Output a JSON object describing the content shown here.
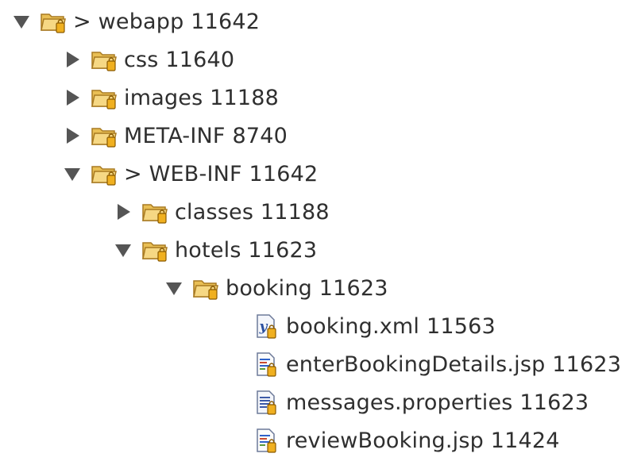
{
  "tree": {
    "webapp": {
      "prefix": ">",
      "name": "webapp",
      "rev": "11642"
    },
    "css": {
      "name": "css",
      "rev": "11640"
    },
    "images": {
      "name": "images",
      "rev": "11188"
    },
    "meta_inf": {
      "name": "META-INF",
      "rev": "8740"
    },
    "web_inf": {
      "prefix": ">",
      "name": "WEB-INF",
      "rev": "11642"
    },
    "classes": {
      "name": "classes",
      "rev": "11188"
    },
    "hotels": {
      "name": "hotels",
      "rev": "11623"
    },
    "booking": {
      "name": "booking",
      "rev": "11623"
    },
    "booking_xml": {
      "name": "booking.xml",
      "rev": "11563"
    },
    "enter_booking_details": {
      "name": "enterBookingDetails.jsp",
      "rev": "11623"
    },
    "messages_properties": {
      "name": "messages.properties",
      "rev": "11623"
    },
    "review_booking": {
      "name": "reviewBooking.jsp",
      "rev": "11424"
    }
  },
  "colors": {
    "folder_fill": "#f2cf72",
    "folder_stroke": "#b8862b",
    "twisty": "#555555",
    "lock_fill": "#f0b020",
    "xml_y": "#2a4f9e"
  },
  "icons": {
    "expanded": "triangle-down-icon",
    "collapsed": "triangle-right-icon",
    "folder": "folder-icon",
    "xml": "xml-file-icon",
    "jsp": "jsp-file-icon",
    "properties": "properties-file-icon",
    "lock": "lock-badge-icon"
  }
}
